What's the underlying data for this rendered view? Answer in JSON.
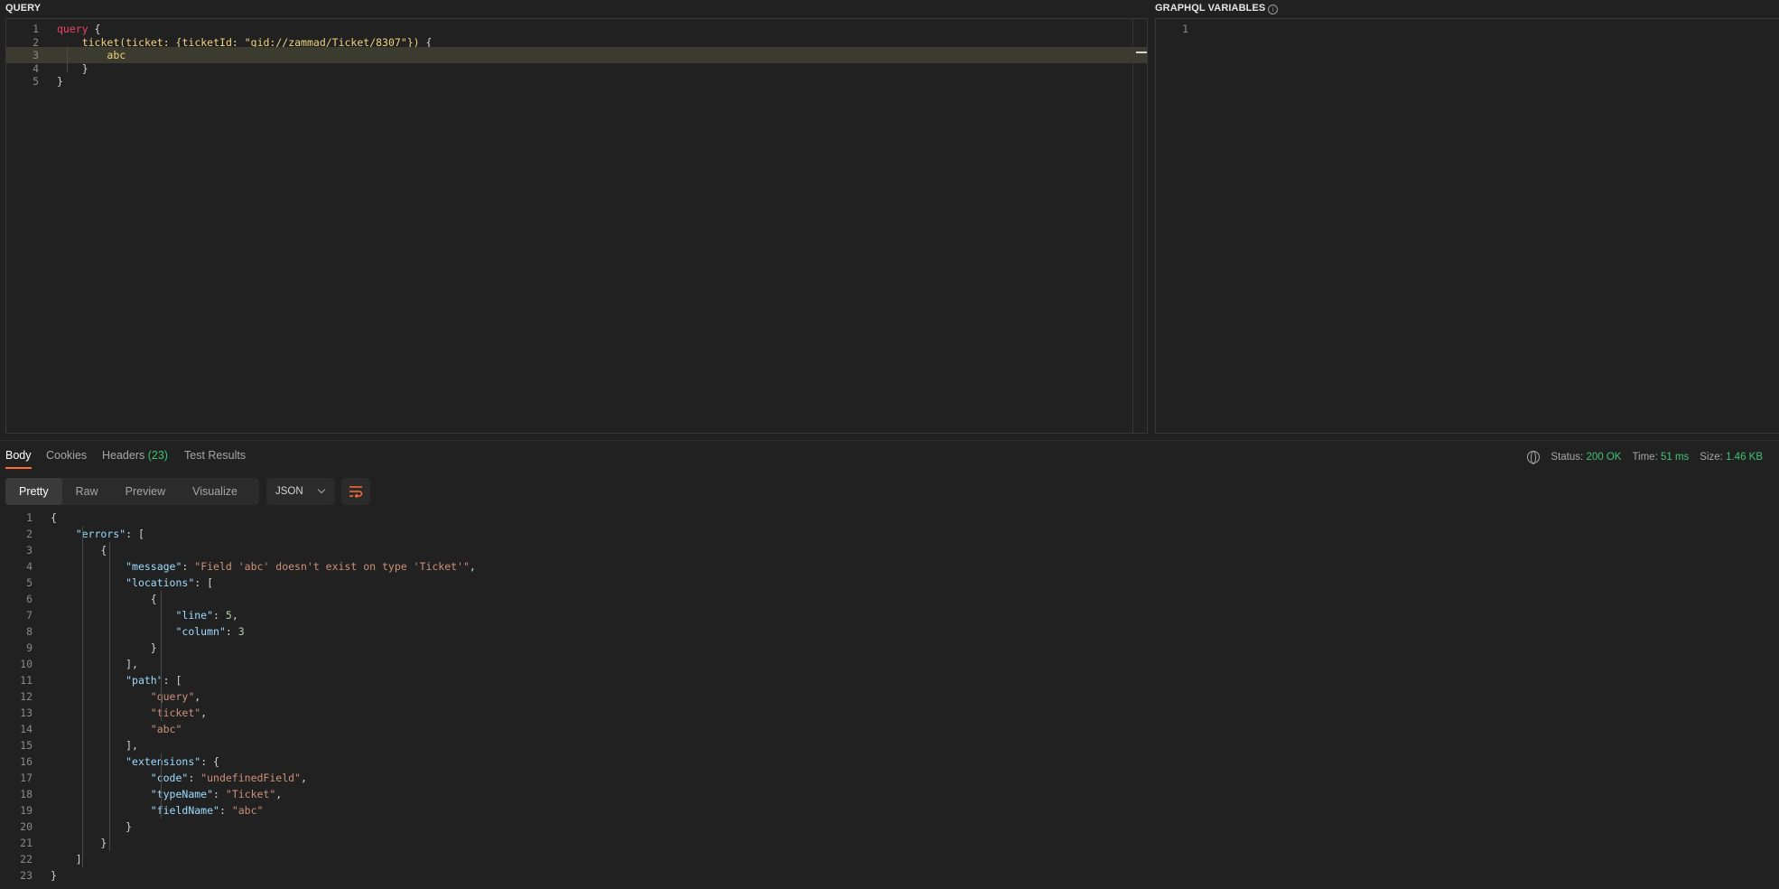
{
  "query_pane": {
    "title": "QUERY",
    "lines": [
      {
        "n": "1",
        "t": [
          [
            "kw",
            "query"
          ],
          [
            "pun",
            " {"
          ]
        ]
      },
      {
        "n": "2",
        "t": [
          [
            "pun",
            "    "
          ],
          [
            "fn",
            "ticket"
          ],
          [
            "fn",
            "(ticket: {ticketId: "
          ],
          [
            "str-y",
            "\"gid://zammad/Ticket/8307\""
          ],
          [
            "fn",
            "}) "
          ],
          [
            "pun",
            "{"
          ]
        ]
      },
      {
        "n": "3",
        "t": [
          [
            "pun",
            "        "
          ],
          [
            "fn",
            "abc"
          ]
        ]
      },
      {
        "n": "4",
        "t": [
          [
            "pun",
            "    }"
          ]
        ]
      },
      {
        "n": "5",
        "t": [
          [
            "pun",
            "}"
          ]
        ]
      }
    ]
  },
  "variables_pane": {
    "title": "GRAPHQL VARIABLES",
    "info_icon": "info-icon",
    "lines": [
      {
        "n": "1",
        "t": []
      }
    ]
  },
  "response_tabs": [
    {
      "label": "Body",
      "active": true
    },
    {
      "label": "Cookies"
    },
    {
      "label": "Headers",
      "count": "(23)"
    },
    {
      "label": "Test Results"
    }
  ],
  "status": {
    "status_label": "Status:",
    "status_value": "200 OK",
    "time_label": "Time:",
    "time_value": "51 ms",
    "size_label": "Size:",
    "size_value": "1.46 KB",
    "icon": "globe-icon"
  },
  "view_modes": [
    "Pretty",
    "Raw",
    "Preview",
    "Visualize"
  ],
  "active_view": "Pretty",
  "format_select": {
    "value": "JSON"
  },
  "response_lines": [
    {
      "n": "1",
      "t": [
        [
          "pun",
          "{"
        ]
      ]
    },
    {
      "n": "2",
      "t": [
        [
          "pun",
          "    "
        ],
        [
          "key",
          "\"errors\""
        ],
        [
          "pun",
          ": ["
        ]
      ]
    },
    {
      "n": "3",
      "t": [
        [
          "pun",
          "        {"
        ]
      ]
    },
    {
      "n": "4",
      "t": [
        [
          "pun",
          "            "
        ],
        [
          "key",
          "\"message\""
        ],
        [
          "pun",
          ": "
        ],
        [
          "str",
          "\"Field 'abc' doesn't exist on type 'Ticket'\""
        ],
        [
          "pun",
          ","
        ]
      ]
    },
    {
      "n": "5",
      "t": [
        [
          "pun",
          "            "
        ],
        [
          "key",
          "\"locations\""
        ],
        [
          "pun",
          ": ["
        ]
      ]
    },
    {
      "n": "6",
      "t": [
        [
          "pun",
          "                {"
        ]
      ]
    },
    {
      "n": "7",
      "t": [
        [
          "pun",
          "                    "
        ],
        [
          "key",
          "\"line\""
        ],
        [
          "pun",
          ": "
        ],
        [
          "num",
          "5"
        ],
        [
          "pun",
          ","
        ]
      ]
    },
    {
      "n": "8",
      "t": [
        [
          "pun",
          "                    "
        ],
        [
          "key",
          "\"column\""
        ],
        [
          "pun",
          ": "
        ],
        [
          "num",
          "3"
        ]
      ]
    },
    {
      "n": "9",
      "t": [
        [
          "pun",
          "                }"
        ]
      ]
    },
    {
      "n": "10",
      "t": [
        [
          "pun",
          "            ],"
        ]
      ]
    },
    {
      "n": "11",
      "t": [
        [
          "pun",
          "            "
        ],
        [
          "key",
          "\"path\""
        ],
        [
          "pun",
          ": ["
        ]
      ]
    },
    {
      "n": "12",
      "t": [
        [
          "pun",
          "                "
        ],
        [
          "str",
          "\"query\""
        ],
        [
          "pun",
          ","
        ]
      ]
    },
    {
      "n": "13",
      "t": [
        [
          "pun",
          "                "
        ],
        [
          "str",
          "\"ticket\""
        ],
        [
          "pun",
          ","
        ]
      ]
    },
    {
      "n": "14",
      "t": [
        [
          "pun",
          "                "
        ],
        [
          "str",
          "\"abc\""
        ]
      ]
    },
    {
      "n": "15",
      "t": [
        [
          "pun",
          "            ],"
        ]
      ]
    },
    {
      "n": "16",
      "t": [
        [
          "pun",
          "            "
        ],
        [
          "key",
          "\"extensions\""
        ],
        [
          "pun",
          ": {"
        ]
      ]
    },
    {
      "n": "17",
      "t": [
        [
          "pun",
          "                "
        ],
        [
          "key",
          "\"code\""
        ],
        [
          "pun",
          ": "
        ],
        [
          "str",
          "\"undefinedField\""
        ],
        [
          "pun",
          ","
        ]
      ]
    },
    {
      "n": "18",
      "t": [
        [
          "pun",
          "                "
        ],
        [
          "key",
          "\"typeName\""
        ],
        [
          "pun",
          ": "
        ],
        [
          "str",
          "\"Ticket\""
        ],
        [
          "pun",
          ","
        ]
      ]
    },
    {
      "n": "19",
      "t": [
        [
          "pun",
          "                "
        ],
        [
          "key",
          "\"fieldName\""
        ],
        [
          "pun",
          ": "
        ],
        [
          "str",
          "\"abc\""
        ]
      ]
    },
    {
      "n": "20",
      "t": [
        [
          "pun",
          "            }"
        ]
      ]
    },
    {
      "n": "21",
      "t": [
        [
          "pun",
          "        }"
        ]
      ]
    },
    {
      "n": "22",
      "t": [
        [
          "pun",
          "    ]"
        ]
      ]
    },
    {
      "n": "23",
      "t": [
        [
          "pun",
          "}"
        ]
      ]
    }
  ]
}
